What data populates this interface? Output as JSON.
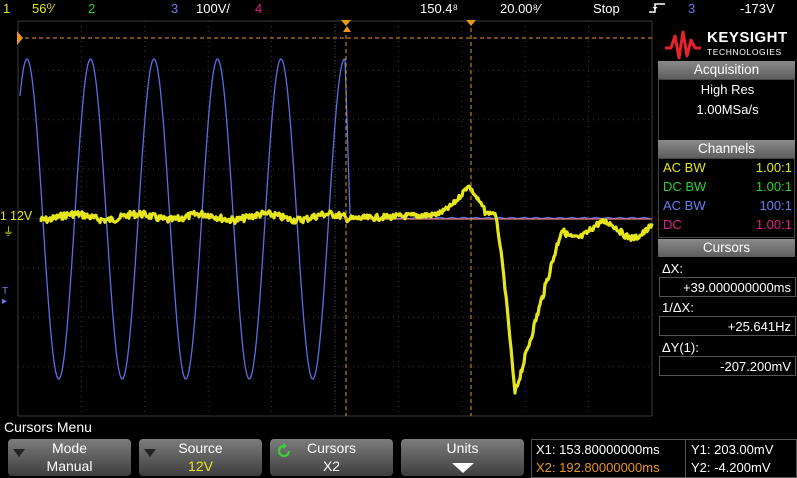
{
  "status_bar": {
    "ch1_num": "1",
    "ch1_scale": "56⁰⁄",
    "ch2_num": "2",
    "ch3_num": "3",
    "ch3_scale": "100V/",
    "ch4_num": "4",
    "time_delay": "150.4⁸",
    "time_scale": "20.00⁸⁄",
    "run_state": "Stop",
    "trigger_source": "3",
    "trigger_level": "-173V"
  },
  "waveform": {
    "ch1_label": "12V",
    "ch1_marker": "1",
    "trigger_marker": "T",
    "colors": {
      "ch1": "#e6e61e",
      "ch3": "#5a6ee6",
      "cursor": "#e8961e",
      "ref": "#e67878",
      "grid": "#3a3a3a"
    }
  },
  "brand": {
    "name": "KEYSIGHT",
    "sub": "TECHNOLOGIES"
  },
  "acquisition": {
    "header": "Acquisition",
    "mode": "High Res",
    "rate": "1.00MSa/s"
  },
  "channels": {
    "header": "Channels",
    "rows": [
      {
        "coupling": "AC BW",
        "ratio": "1.00:1",
        "color": "#e6e61e"
      },
      {
        "coupling": "DC BW",
        "ratio": "1.00:1",
        "color": "#2ed12e"
      },
      {
        "coupling": "AC BW",
        "ratio": "100:1",
        "color": "#6a7cf0"
      },
      {
        "coupling": "DC",
        "ratio": "1.00:1",
        "color": "#e0208a"
      }
    ]
  },
  "cursors_panel": {
    "header": "Cursors",
    "dx_label": "ΔX:",
    "dx_value": "+39.000000000ms",
    "inv_dx_label": "1/ΔX:",
    "inv_dx_value": "+25.641Hz",
    "dy_label": "ΔY(1):",
    "dy_value": "-207.200mV"
  },
  "menu": {
    "title": "Cursors Menu",
    "softkeys": [
      {
        "label": "Mode",
        "value": "Manual"
      },
      {
        "label": "Source",
        "value": "12V"
      },
      {
        "label": "Cursors",
        "value": "X2"
      },
      {
        "label": "Units",
        "value": ""
      }
    ]
  },
  "readout": {
    "x1": "X1: 153.80000000ms",
    "x2": "X2: 192.80000000ms",
    "y1": "Y1: 203.00mV",
    "y2": "Y2: -4.200mV"
  }
}
